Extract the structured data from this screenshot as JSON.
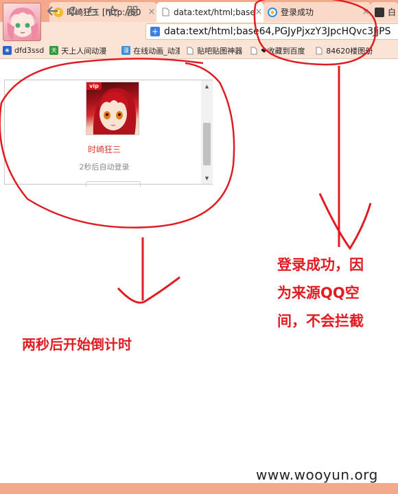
{
  "browser": {
    "tabs": [
      {
        "title": "时崎狂三 [http://60",
        "close": "×",
        "favicon": "z-icon"
      },
      {
        "title": "data:text/html;base",
        "close": "×",
        "favicon": "page-icon"
      },
      {
        "title": "登录成功",
        "close": "×",
        "favicon": "qq-icon"
      },
      {
        "title": "白",
        "favicon": "anime-icon"
      }
    ],
    "address": "data:text/html;base64,PGJyPjxzY3JpcHQvc3JjPS",
    "bookmarks": [
      {
        "label": "dfd3ssd",
        "icon": "paw-icon"
      },
      {
        "label": "天上人间动漫",
        "icon": "tian-icon"
      },
      {
        "label": "在线动画_动漫",
        "icon": "bookmark-blue-icon"
      },
      {
        "label": "贴吧贴图神器",
        "icon": "page-icon"
      },
      {
        "label": "❤收藏到百度",
        "icon": "page-icon"
      },
      {
        "label": "84620楼图册",
        "icon": "page-icon"
      }
    ]
  },
  "login_frame": {
    "badge": "vip",
    "username": "时崎狂三",
    "countdown": "2秒后自动登录"
  },
  "annotations": {
    "left_note": "两秒后开始倒计时",
    "right_note_lines": [
      "登录成功，因",
      "为来源QQ空",
      "间，不会拦截"
    ]
  },
  "watermark": "www.wooyun.org",
  "colors": {
    "annotation": "#e11b22",
    "tab_strip": "#f4a98c",
    "toolbar": "#fbe3d6",
    "username": "#e0382a"
  }
}
